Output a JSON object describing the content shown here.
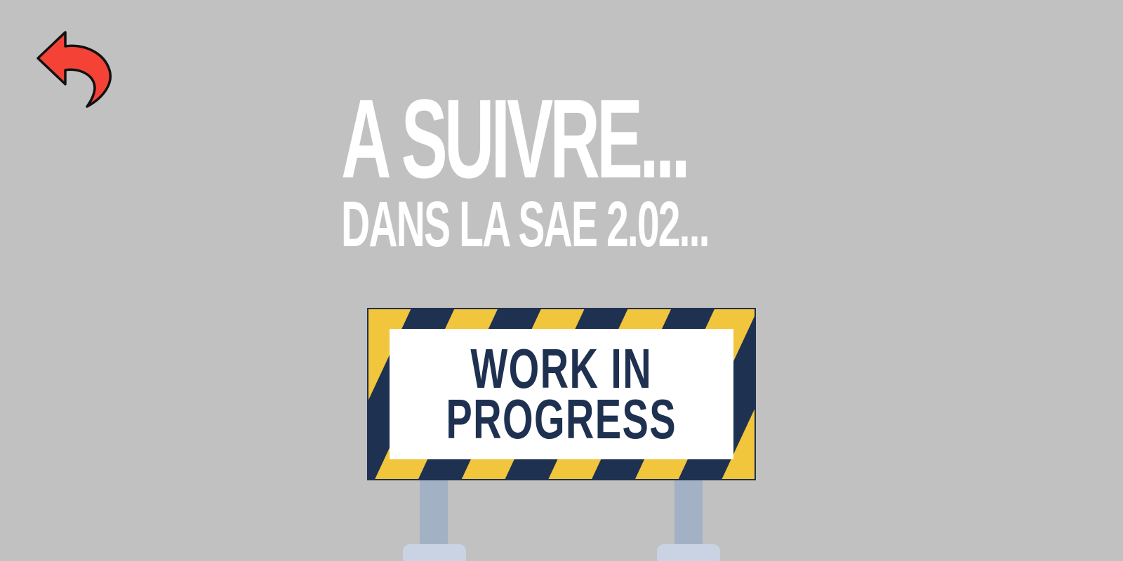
{
  "back": {
    "icon": "undo-arrow-icon",
    "color": "#f44336"
  },
  "headline": {
    "main": "A SUIVRE...",
    "sub": "DANS LA SAE 2.02..."
  },
  "sign": {
    "line1": "WORK IN",
    "line2": "PROGRESS",
    "stripe_yellow": "#f1c53c",
    "stripe_navy": "#1f3150",
    "post_color": "#a3b1c4"
  },
  "colors": {
    "background": "#c1c1c1",
    "text": "#ffffff"
  }
}
